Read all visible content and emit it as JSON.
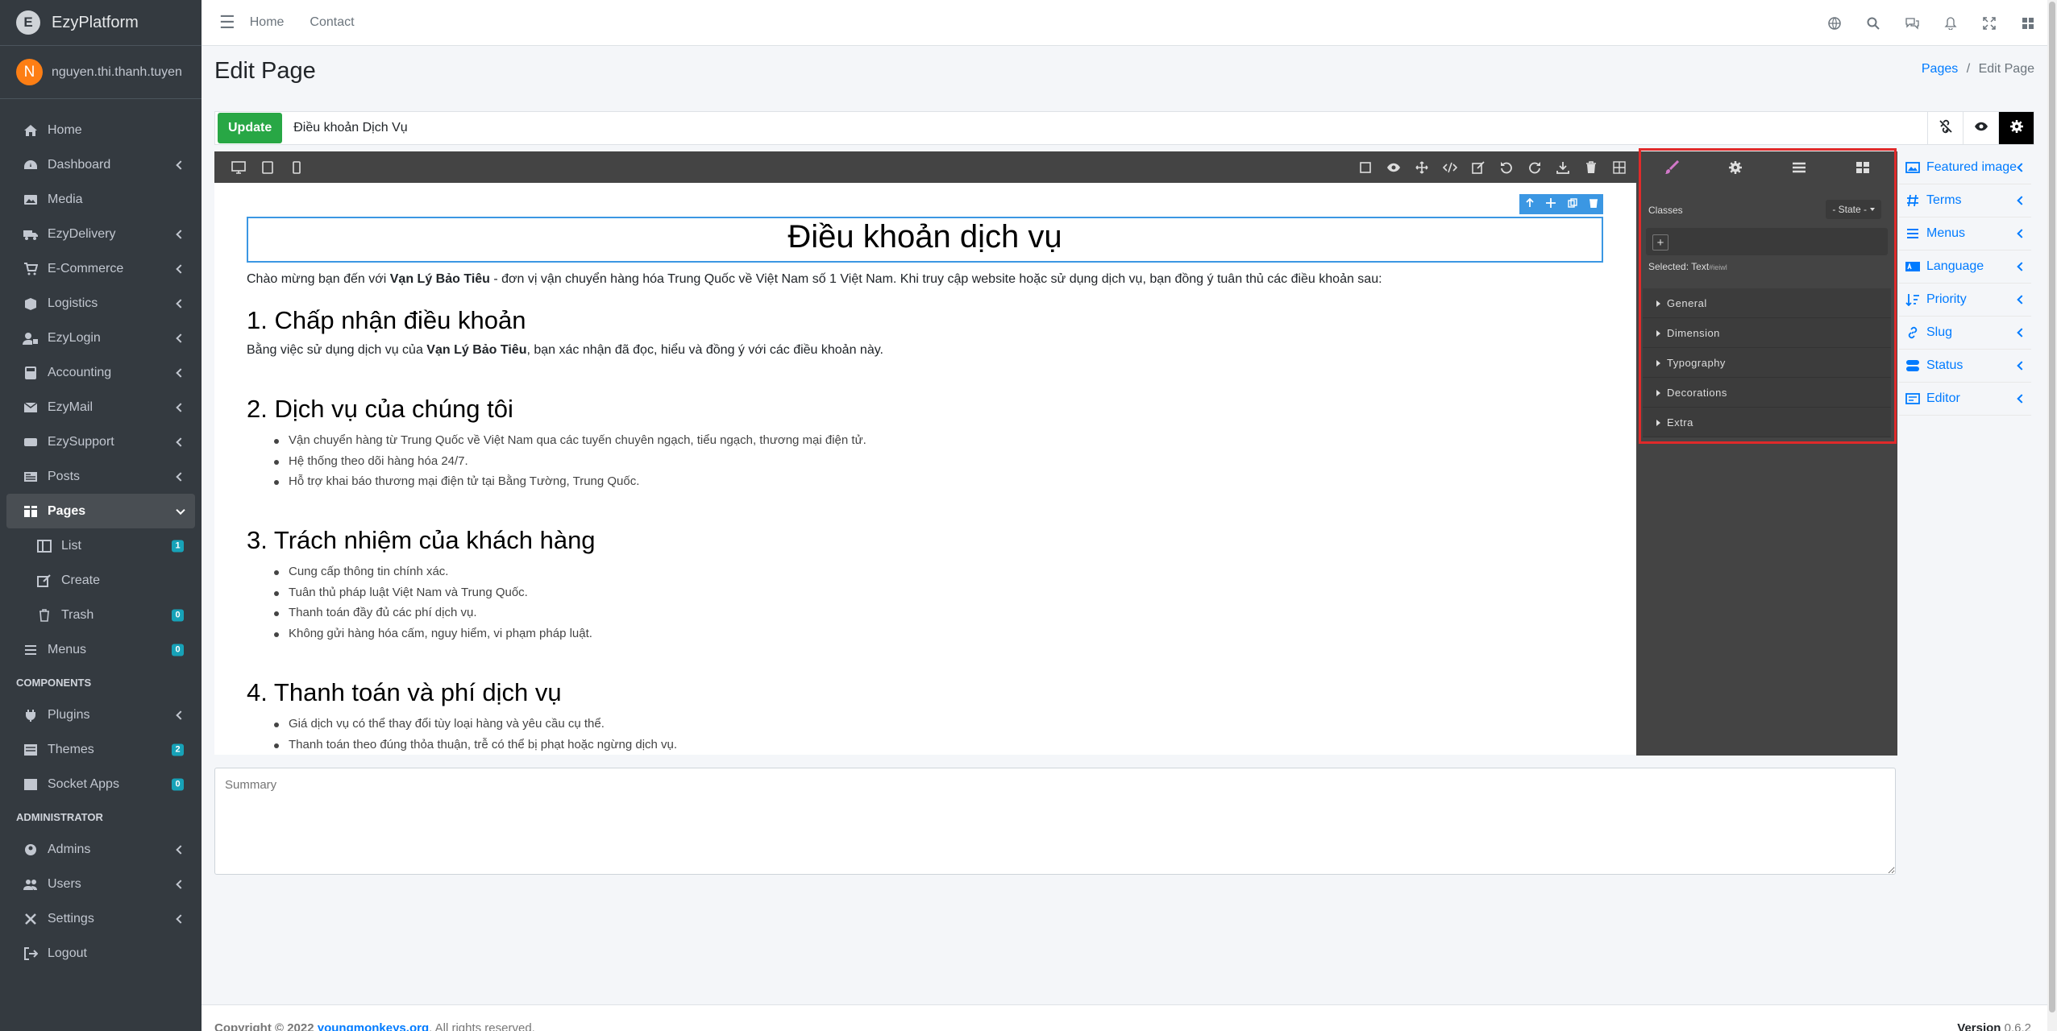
{
  "app": {
    "title": "EzyPlatform"
  },
  "user": {
    "initial": "N",
    "name": "nguyen.thi.thanh.tuyen"
  },
  "sidebar": {
    "items": [
      {
        "label": "Home",
        "icon": "home-icon"
      },
      {
        "label": "Dashboard",
        "icon": "dashboard-icon",
        "arrow": true
      },
      {
        "label": "Media",
        "icon": "media-icon"
      },
      {
        "label": "EzyDelivery",
        "icon": "truck-icon",
        "arrow": true
      },
      {
        "label": "E-Commerce",
        "icon": "cart-icon",
        "arrow": true
      },
      {
        "label": "Logistics",
        "icon": "box-icon",
        "arrow": true
      },
      {
        "label": "EzyLogin",
        "icon": "user-lock-icon",
        "arrow": true
      },
      {
        "label": "Accounting",
        "icon": "calculator-icon",
        "arrow": true
      },
      {
        "label": "EzyMail",
        "icon": "mail-icon",
        "arrow": true
      },
      {
        "label": "EzySupport",
        "icon": "support-icon",
        "arrow": true
      },
      {
        "label": "Posts",
        "icon": "posts-icon",
        "arrow": true
      },
      {
        "label": "Pages",
        "icon": "pages-icon",
        "arrow": true,
        "active": true
      }
    ],
    "pages_sub": [
      {
        "label": "List",
        "badge": "1"
      },
      {
        "label": "Create"
      },
      {
        "label": "Trash",
        "badge": "0"
      }
    ],
    "menus": {
      "label": "Menus",
      "badge": "0"
    },
    "components_header": "COMPONENTS",
    "components": [
      {
        "label": "Plugins",
        "arrow": true
      },
      {
        "label": "Themes",
        "badge": "2"
      },
      {
        "label": "Socket Apps",
        "badge": "0"
      }
    ],
    "admin_header": "ADMINISTRATOR",
    "admin": [
      {
        "label": "Admins"
      },
      {
        "label": "Users"
      },
      {
        "label": "Settings"
      },
      {
        "label": "Logout"
      }
    ]
  },
  "topnav": {
    "home": "Home",
    "contact": "Contact"
  },
  "page": {
    "title": "Edit Page",
    "breadcrumb": {
      "parent": "Pages",
      "sep": "/",
      "current": "Edit Page"
    },
    "update_label": "Update",
    "title_value": "Điều khoản Dịch Vụ",
    "summary_placeholder": "Summary"
  },
  "content": {
    "h1": "Điều khoản dịch vụ",
    "intro_prefix": "Chào mừng bạn đến với ",
    "intro_brand": "Vạn Lý Bảo Tiêu",
    "intro_suffix": " - đơn vị vận chuyển hàng hóa Trung Quốc về Việt Nam số 1 Việt Nam. Khi truy cập website hoặc sử dụng dịch vụ, bạn đồng ý tuân thủ các điều khoản sau:",
    "s1_title": "1. Chấp nhận điều khoản",
    "s1_prefix": "Bằng việc sử dụng dịch vụ của ",
    "s1_brand": "Vạn Lý Bảo Tiêu",
    "s1_suffix": ", bạn xác nhận đã đọc, hiểu và đồng ý với các điều khoản này.",
    "s2_title": "2. Dịch vụ của chúng tôi",
    "s2_items": [
      "Vận chuyển hàng từ Trung Quốc về Việt Nam qua các tuyến chuyên ngạch, tiểu ngạch, thương mại điện tử.",
      "Hệ thống theo dõi hàng hóa 24/7.",
      "Hỗ trợ khai báo thương mại điện tử tại Bằng Tường, Trung Quốc."
    ],
    "s3_title": "3. Trách nhiệm của khách hàng",
    "s3_items": [
      "Cung cấp thông tin chính xác.",
      "Tuân thủ pháp luật Việt Nam và Trung Quốc.",
      "Thanh toán đầy đủ các phí dịch vụ.",
      "Không gửi hàng hóa cấm, nguy hiểm, vi phạm pháp luật."
    ],
    "s4_title": "4. Thanh toán và phí dịch vụ",
    "s4_items": [
      "Giá dịch vụ có thể thay đổi tùy loại hàng và yêu cầu cụ thể.",
      "Thanh toán theo đúng thỏa thuận, trễ có thể bị phạt hoặc ngừng dịch vụ."
    ]
  },
  "style_panel": {
    "classes_label": "Classes",
    "state_label": "- State -",
    "add_label": "+",
    "selected_label": "Selected:",
    "selected_type": "Text",
    "selected_id": "#ieiwl",
    "sectors": [
      "General",
      "Dimension",
      "Typography",
      "Decorations",
      "Extra"
    ]
  },
  "right_sidebar": [
    {
      "label": "Featured image"
    },
    {
      "label": "Terms"
    },
    {
      "label": "Menus"
    },
    {
      "label": "Language"
    },
    {
      "label": "Priority"
    },
    {
      "label": "Slug"
    },
    {
      "label": "Status"
    },
    {
      "label": "Editor"
    }
  ],
  "footer": {
    "copyright": "Copyright © 2022 ",
    "link": "youngmonkeys.org",
    "rights": ". All rights reserved.",
    "version_label": "Version",
    "version": " 0.6.2"
  },
  "colors": {
    "accent": "#007bff",
    "update": "#28a745",
    "highlight": "#e02a2a",
    "sidebar": "#343a40",
    "editor": "#444444"
  }
}
